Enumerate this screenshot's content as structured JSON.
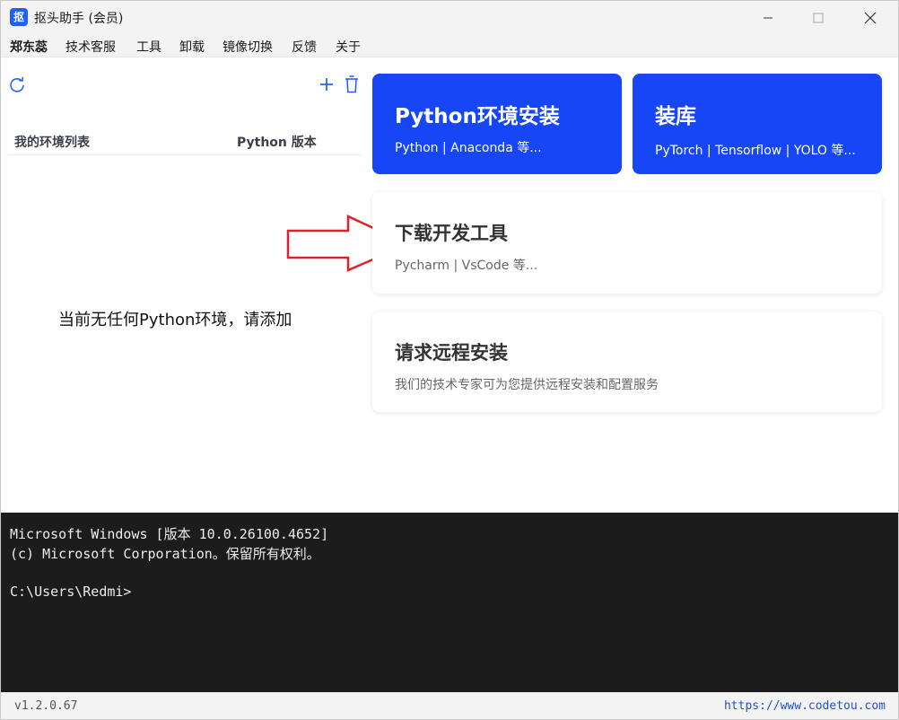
{
  "window": {
    "title": "抠头助手 (会员)",
    "icon_text": "抠"
  },
  "menu": {
    "user": "郑东蕊",
    "items": [
      "技术客服",
      "工具",
      "卸载",
      "镜像切换",
      "反馈",
      "关于"
    ]
  },
  "env_list": {
    "col_name": "我的环境列表",
    "col_version": "Python 版本",
    "empty_message": "当前无任何Python环境，请添加"
  },
  "cards": [
    {
      "title": "Python环境安装",
      "subtitle": "Python | Anaconda 等..."
    },
    {
      "title": "装库",
      "subtitle": "PyTorch | Tensorflow | YOLO 等..."
    },
    {
      "title": "下载开发工具",
      "subtitle": "Pycharm | VsCode 等..."
    },
    {
      "title": "请求远程安装",
      "subtitle": "我们的技术专家可为您提供远程安装和配置服务"
    }
  ],
  "terminal": {
    "lines": [
      "Microsoft Windows [版本 10.0.26100.4652]",
      "(c) Microsoft Corporation。保留所有权利。",
      "",
      "C:\\Users\\Redmi>"
    ]
  },
  "status": {
    "version": "v1.2.0.67",
    "website": "https://www.codetou.com"
  },
  "colors": {
    "accent_blue": "#1646f5",
    "annotation_red": "#e0202a",
    "terminal_bg": "#1c1c1c"
  },
  "icons": {
    "refresh": "refresh-icon",
    "add": "plus-icon",
    "delete": "trash-icon",
    "minimize": "minimize-icon",
    "maximize": "maximize-icon",
    "close": "close-icon",
    "annotation": "arrow-right-icon"
  }
}
